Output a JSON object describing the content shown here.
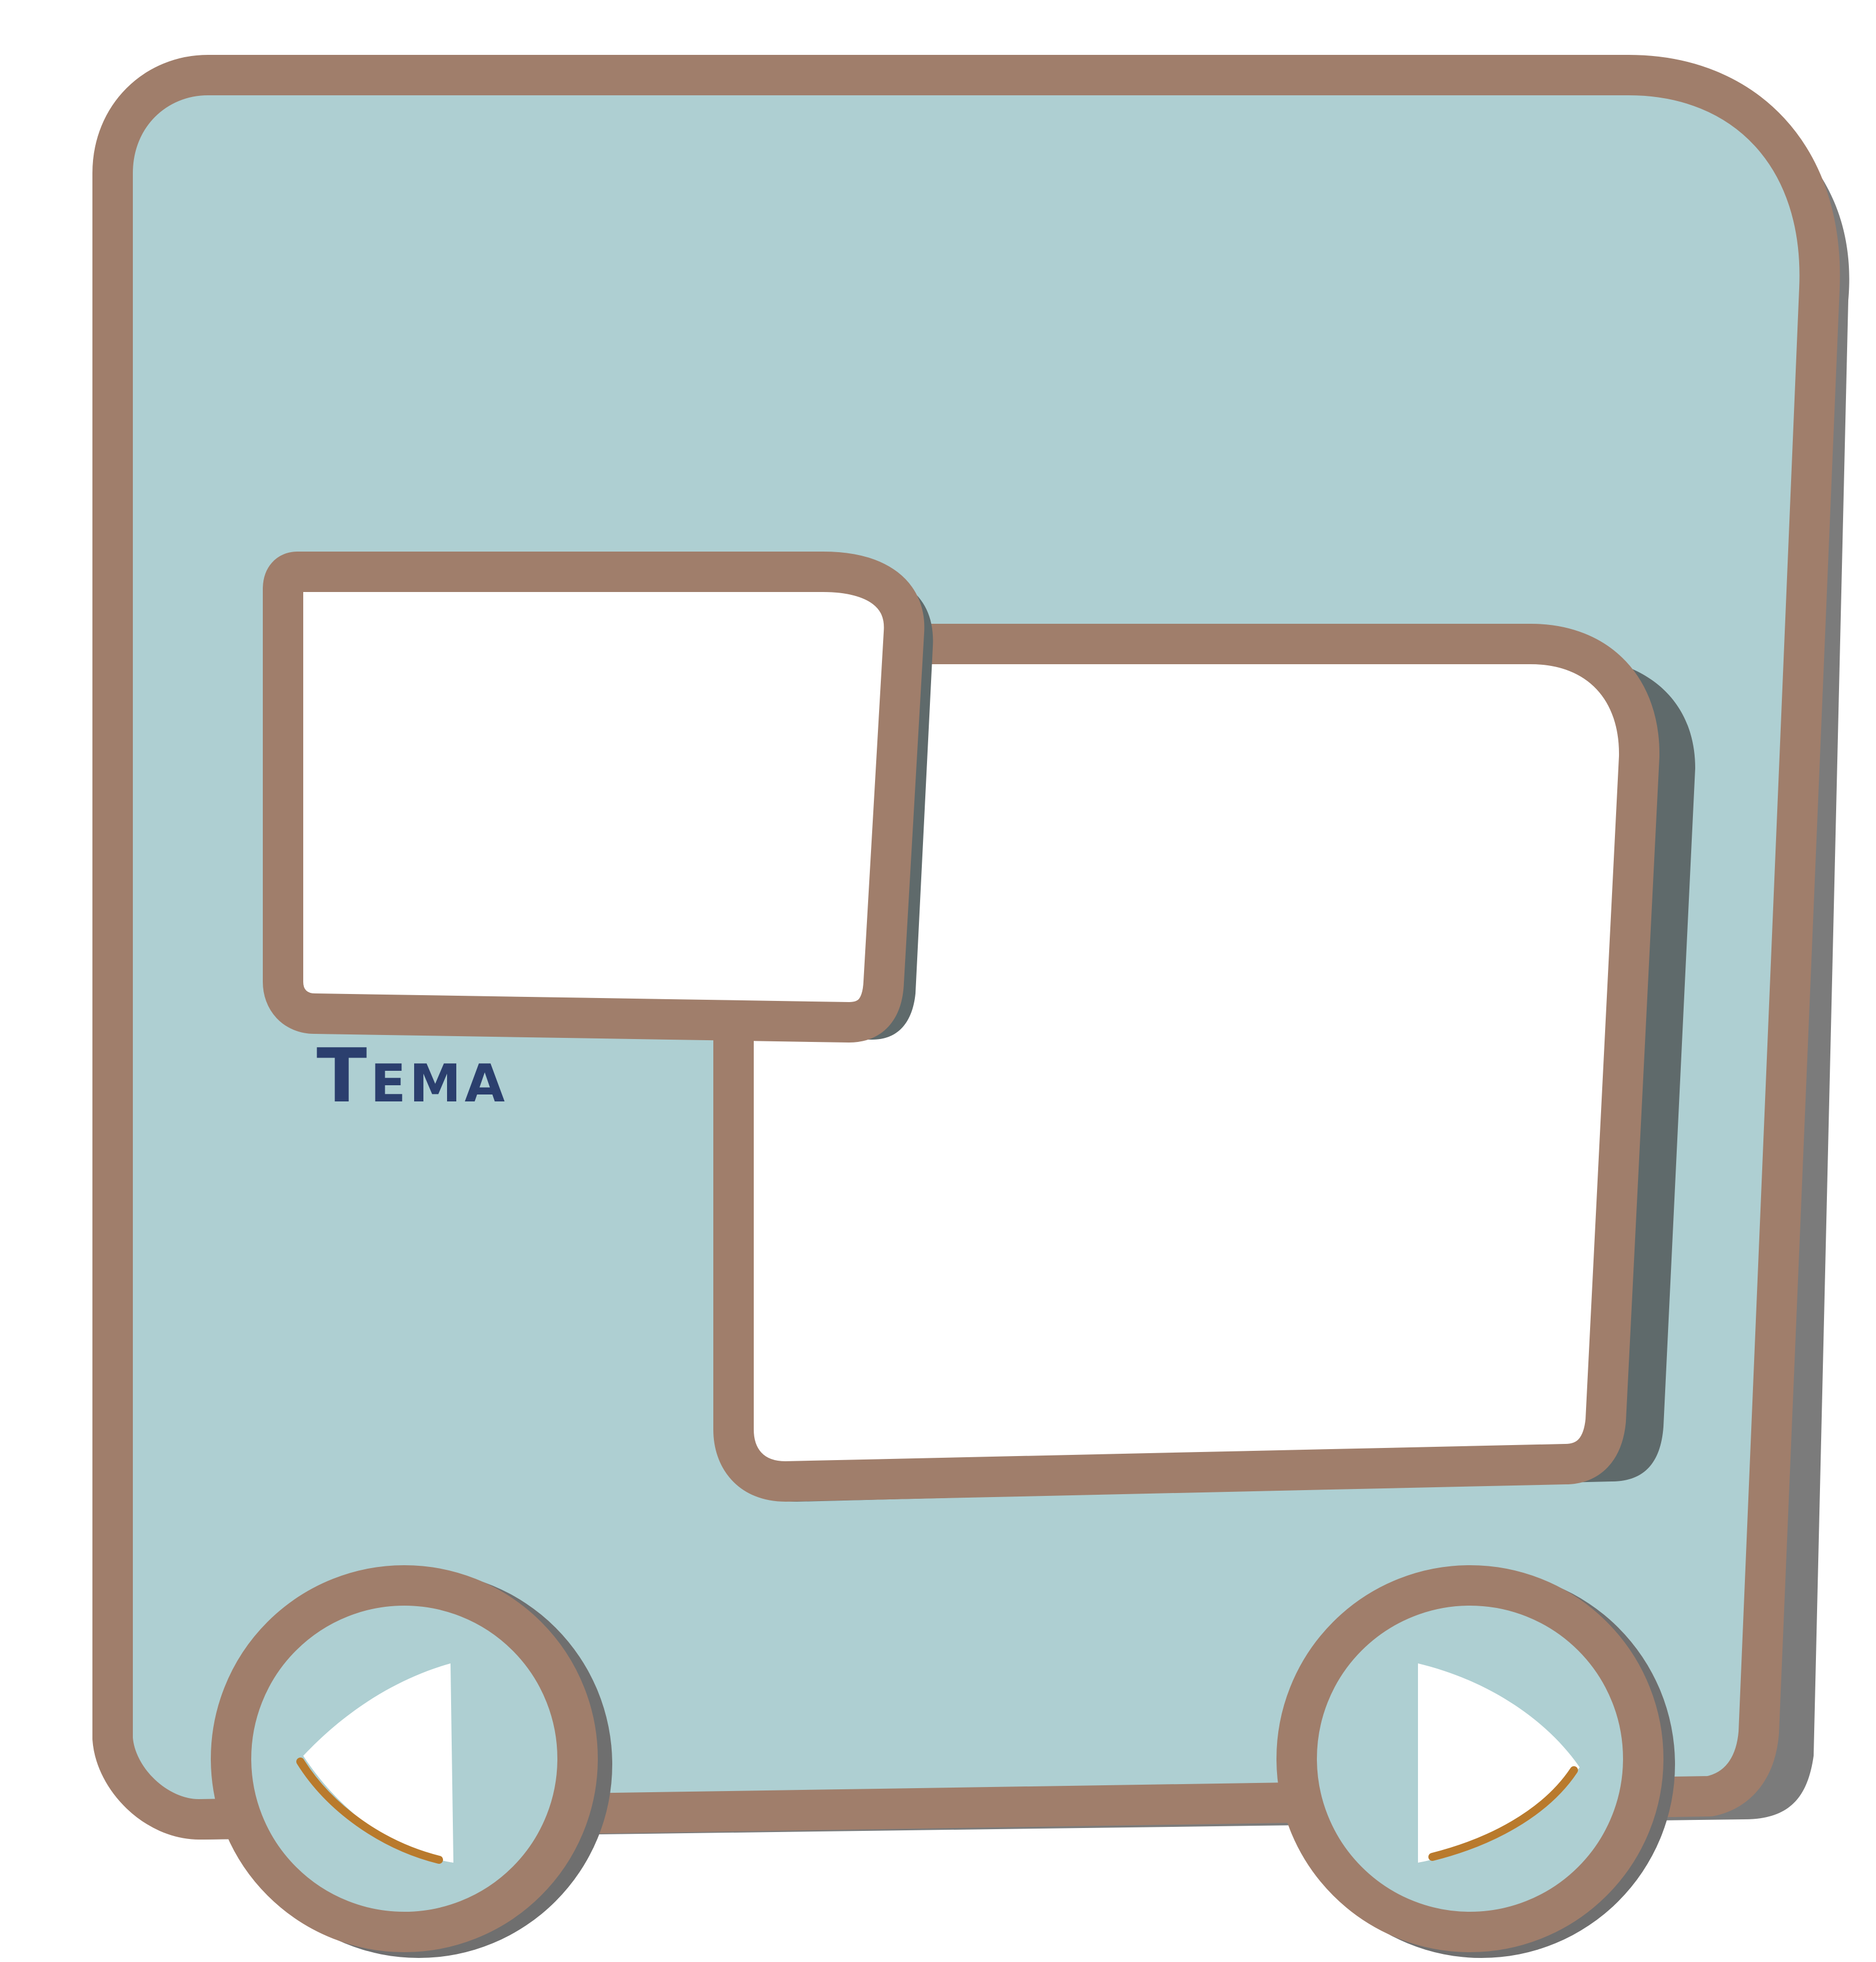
{
  "card": {
    "title": "Tema",
    "image_slot_small": "",
    "image_slot_large": ""
  },
  "nav": {
    "prev_icon": "triangle-left-icon",
    "next_icon": "triangle-right-icon"
  },
  "colors": {
    "panel_fill": "#aecfd2",
    "frame_border": "#a07e6b",
    "shadow": "#7b7b7b",
    "slot_fill": "#ffffff",
    "title_text": "#2b3f6e",
    "arrow_accent": "#b97a2c"
  }
}
